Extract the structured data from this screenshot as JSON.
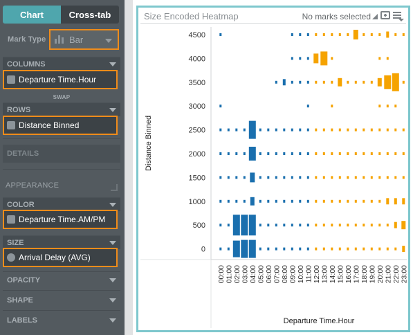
{
  "tabs": {
    "chart": "Chart",
    "crosstab": "Cross-tab"
  },
  "mark_type": {
    "label": "Mark Type",
    "value": "Bar",
    "icon": "bar-chart-icon"
  },
  "columns": {
    "header": "COLUMNS",
    "pill": "Departure Time.Hour",
    "swap": "SWAP"
  },
  "rows": {
    "header": "ROWS",
    "pill": "Distance Binned"
  },
  "details": {
    "header": "DETAILS"
  },
  "appearance": {
    "header": "APPEARANCE"
  },
  "color": {
    "header": "COLOR",
    "pill": "Departure Time.AM/PM"
  },
  "size": {
    "header": "SIZE",
    "pill": "Arrival Delay (AVG)"
  },
  "opacity": {
    "header": "OPACITY"
  },
  "shape": {
    "header": "SHAPE"
  },
  "labels": {
    "header": "LABELS"
  },
  "chart": {
    "title": "Size Encoded Heatmap",
    "status": "No marks selected",
    "accent": "#7ec7cd",
    "highlight": "#f08c1a"
  },
  "chart_data": {
    "type": "heatmap",
    "x_label": "Departure Time.Hour",
    "y_label": "Distance Binned",
    "x_categories": [
      "00:00",
      "01:00",
      "02:00",
      "03:00",
      "04:00",
      "05:00",
      "06:00",
      "07:00",
      "08:00",
      "09:00",
      "10:00",
      "11:00",
      "12:00",
      "13:00",
      "14:00",
      "15:00",
      "16:00",
      "17:00",
      "18:00",
      "19:00",
      "20:00",
      "21:00",
      "22:00",
      "23:00"
    ],
    "y_categories": [
      "4500",
      "4000",
      "3500",
      "3000",
      "2500",
      "2000",
      "1500",
      "1000",
      "500",
      "0"
    ],
    "color_legend": {
      "AM": "#1a6fae",
      "PM": "#f5a300"
    },
    "size_measure": "Arrival Delay (AVG)",
    "size_relative": [
      [
        1,
        0,
        0,
        0,
        0,
        0,
        0,
        0,
        0,
        1,
        1,
        1,
        1,
        1,
        1,
        1,
        1,
        4,
        1,
        1,
        1,
        2,
        1,
        1
      ],
      [
        0,
        0,
        0,
        0,
        0,
        0,
        0,
        0,
        0,
        1,
        1,
        1,
        4,
        6,
        1,
        0,
        0,
        0,
        0,
        0,
        1,
        1,
        0,
        0
      ],
      [
        0,
        0,
        0,
        0,
        0,
        0,
        0,
        1,
        2,
        1,
        1,
        1,
        1,
        1,
        1,
        3,
        1,
        1,
        1,
        1,
        3,
        6,
        7,
        1
      ],
      [
        1,
        0,
        0,
        0,
        0,
        0,
        0,
        0,
        0,
        0,
        0,
        1,
        0,
        0,
        1,
        0,
        0,
        0,
        0,
        0,
        1,
        1,
        1,
        0
      ],
      [
        1,
        1,
        1,
        1,
        7,
        1,
        1,
        1,
        1,
        1,
        1,
        1,
        1,
        1,
        1,
        1,
        1,
        1,
        1,
        1,
        1,
        1,
        1,
        1
      ],
      [
        1,
        1,
        1,
        1,
        6,
        1,
        1,
        1,
        1,
        1,
        1,
        1,
        1,
        1,
        1,
        1,
        1,
        1,
        1,
        1,
        1,
        1,
        1,
        1
      ],
      [
        1,
        1,
        1,
        1,
        4,
        1,
        1,
        1,
        1,
        1,
        1,
        1,
        1,
        1,
        1,
        1,
        1,
        1,
        1,
        1,
        1,
        1,
        1,
        1
      ],
      [
        1,
        1,
        1,
        1,
        3,
        1,
        1,
        1,
        1,
        1,
        1,
        1,
        1,
        1,
        1,
        1,
        1,
        1,
        1,
        1,
        1,
        2,
        2,
        2
      ],
      [
        1,
        1,
        9,
        9,
        9,
        1,
        1,
        1,
        1,
        1,
        1,
        1,
        1,
        1,
        1,
        1,
        1,
        1,
        1,
        1,
        1,
        1,
        2,
        3
      ],
      [
        1,
        1,
        8,
        7,
        7,
        1,
        1,
        1,
        1,
        1,
        1,
        1,
        1,
        1,
        1,
        1,
        1,
        1,
        1,
        1,
        1,
        1,
        1,
        2
      ]
    ]
  }
}
